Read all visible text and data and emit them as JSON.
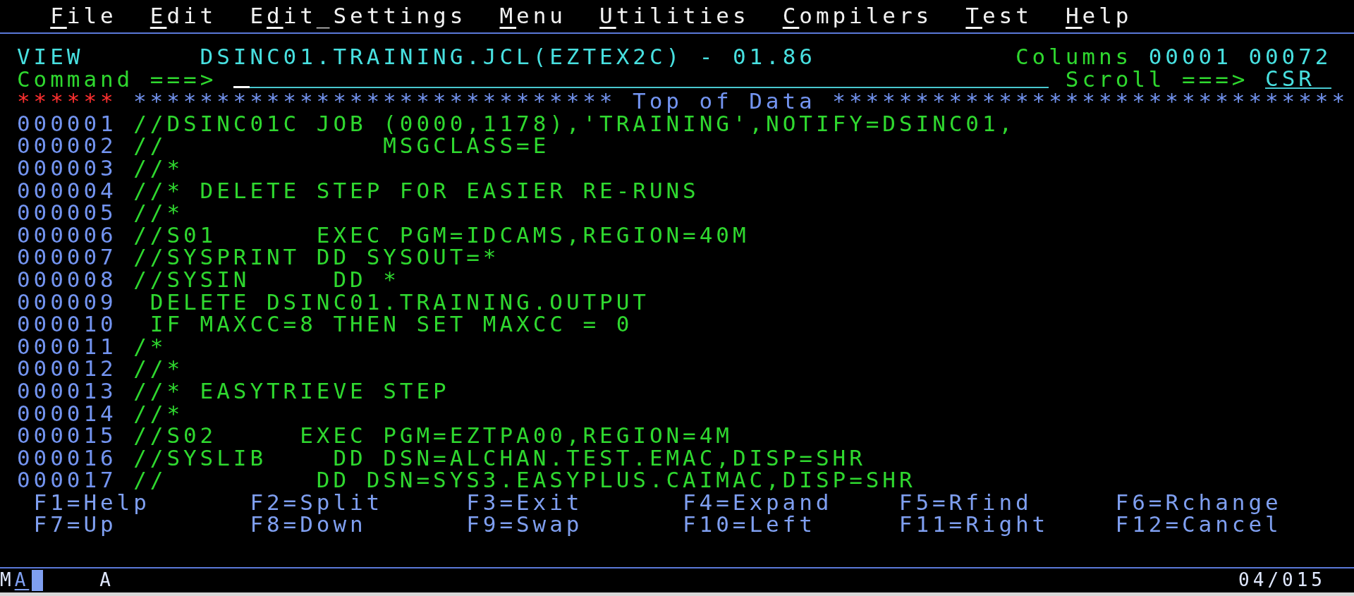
{
  "menu_bar": [
    {
      "hotkey": "F",
      "rest": "ile"
    },
    {
      "hotkey": "E",
      "rest": "dit"
    },
    {
      "lead": "E",
      "hotkey": "d",
      "rest": "it_Settings"
    },
    {
      "hotkey": "M",
      "rest": "enu"
    },
    {
      "hotkey": "U",
      "rest": "tilities"
    },
    {
      "hotkey": "C",
      "rest": "ompilers"
    },
    {
      "hotkey": "T",
      "rest": "est"
    },
    {
      "hotkey": "H",
      "rest": "elp"
    }
  ],
  "header": {
    "mode": "VIEW",
    "dataset": "DSINC01.TRAINING.JCL(EZTEX2C) - 01.86",
    "columns_label": "Columns",
    "columns_range": "00001 00072"
  },
  "command_line": {
    "label": "Command ===>",
    "scroll_label": "Scroll ===>",
    "scroll_value": "CSR"
  },
  "top_marker": {
    "prefix": "******",
    "text": "***************************** Top of Data *******************************"
  },
  "lines": [
    {
      "number": "000001",
      "text": "//DSINC01C JOB (0000,1178),'TRAINING',NOTIFY=DSINC01,"
    },
    {
      "number": "000002",
      "text": "//             MSGCLASS=E"
    },
    {
      "number": "000003",
      "text": "//*"
    },
    {
      "number": "000004",
      "text": "//* DELETE STEP FOR EASIER RE-RUNS"
    },
    {
      "number": "000005",
      "text": "//*"
    },
    {
      "number": "000006",
      "text": "//S01      EXEC PGM=IDCAMS,REGION=40M"
    },
    {
      "number": "000007",
      "text": "//SYSPRINT DD SYSOUT=*"
    },
    {
      "number": "000008",
      "text": "//SYSIN     DD *"
    },
    {
      "number": "000009",
      "text": " DELETE DSINC01.TRAINING.OUTPUT"
    },
    {
      "number": "000010",
      "text": " IF MAXCC=8 THEN SET MAXCC = 0"
    },
    {
      "number": "000011",
      "text": "/*"
    },
    {
      "number": "000012",
      "text": "//*"
    },
    {
      "number": "000013",
      "text": "//* EASYTRIEVE STEP"
    },
    {
      "number": "000014",
      "text": "//*"
    },
    {
      "number": "000015",
      "text": "//S02     EXEC PGM=EZTPA00,REGION=4M"
    },
    {
      "number": "000016",
      "text": "//SYSLIB    DD DSN=ALCHAN.TEST.EMAC,DISP=SHR"
    },
    {
      "number": "000017",
      "text": "//         DD DSN=SYS3.EASYPLUS.CAIMAC,DISP=SHR"
    }
  ],
  "function_keys": [
    {
      "keys": [
        "F1=Help",
        "F2=Split",
        "F3=Exit",
        "F4=Expand",
        "F5=Rfind",
        "F6=Rchange"
      ]
    },
    {
      "keys": [
        "F7=Up",
        "F8=Down",
        "F9=Swap",
        "F10=Left",
        "F11=Right",
        "F12=Cancel"
      ]
    }
  ],
  "status_bar": {
    "indicator_1": "M",
    "indicator_2": "A",
    "indicator_3": "A",
    "cursor_position": "04/015"
  }
}
